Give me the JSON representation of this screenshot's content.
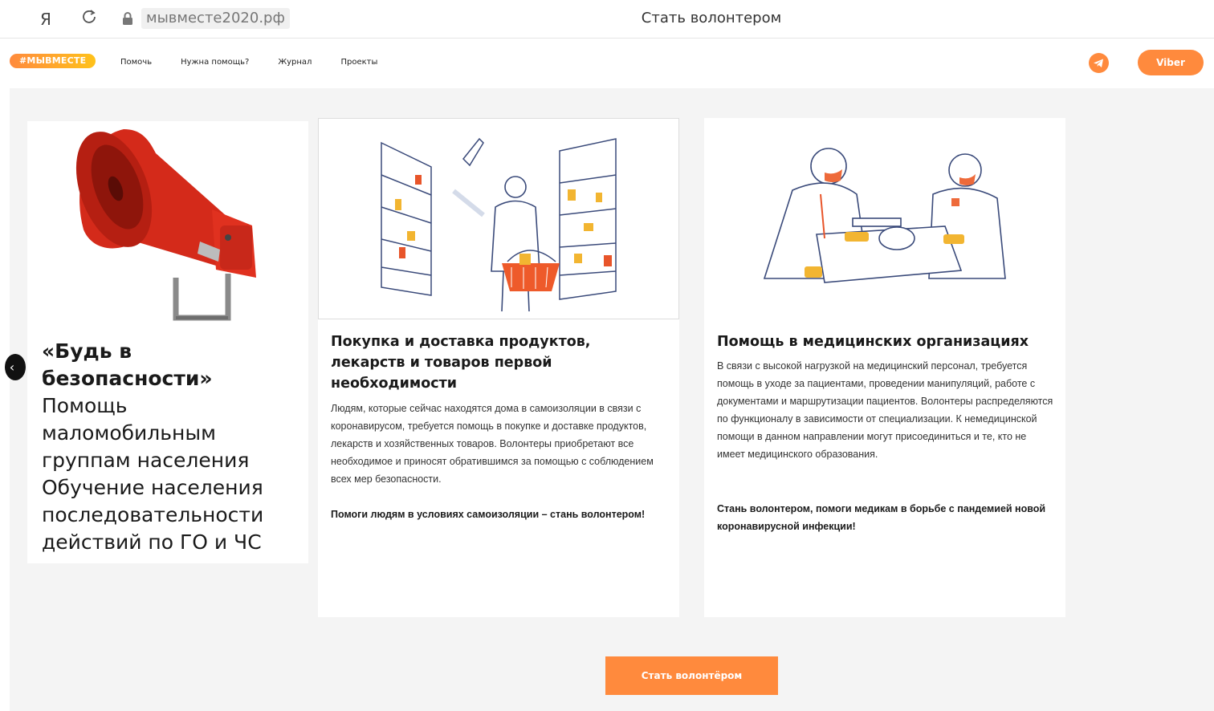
{
  "browser": {
    "yandex_glyph": "Я",
    "address": "мывместе2020.рф",
    "tab_title": "Стать волонтером"
  },
  "header": {
    "logo": "#МЫВМЕСТЕ",
    "nav": [
      "Помочь",
      "Нужна помощь?",
      "Журнал",
      "Проекты"
    ],
    "viber_label": "Viber",
    "accent": "#ff8a3d"
  },
  "cards": [
    {
      "title_bold": "«Будь в безопасности»",
      "title_rest": "Помощь маломобильным группам населения Обучение населения последовательности действий по ГО и ЧС"
    },
    {
      "title": "Покупка и доставка продуктов, лекарств и товаров первой необходимости",
      "text": "Людям, которые сейчас находятся дома в самоизоляции в связи с коронавирусом, требуется помощь в покупке и доставке продуктов, лекарств и хозяйственных товаров. Волонтеры приобретают все необходимое и приносят обратившимся за помощью с соблюдением всех мер безопасности.",
      "cta": "Помоги людям в условиях самоизоляции – стань волонтером!"
    },
    {
      "title": "Помощь в медицинских организациях",
      "text": "В связи с высокой нагрузкой на медицинский персонал, требуется помощь в уходе за пациентами, проведении манипуляций, работе с документами и маршрутизации пациентов. Волонтеры распределяются по функционалу в зависимости от специализации. К немедицинской помощи в данном направлении могут присоединиться и те, кто не имеет медицинского образования.",
      "cta": "Стань волонтером, помоги медикам в борьбе с пандемией новой коронавирусной инфекции!"
    }
  ],
  "main_button": "Стать волонтёром"
}
